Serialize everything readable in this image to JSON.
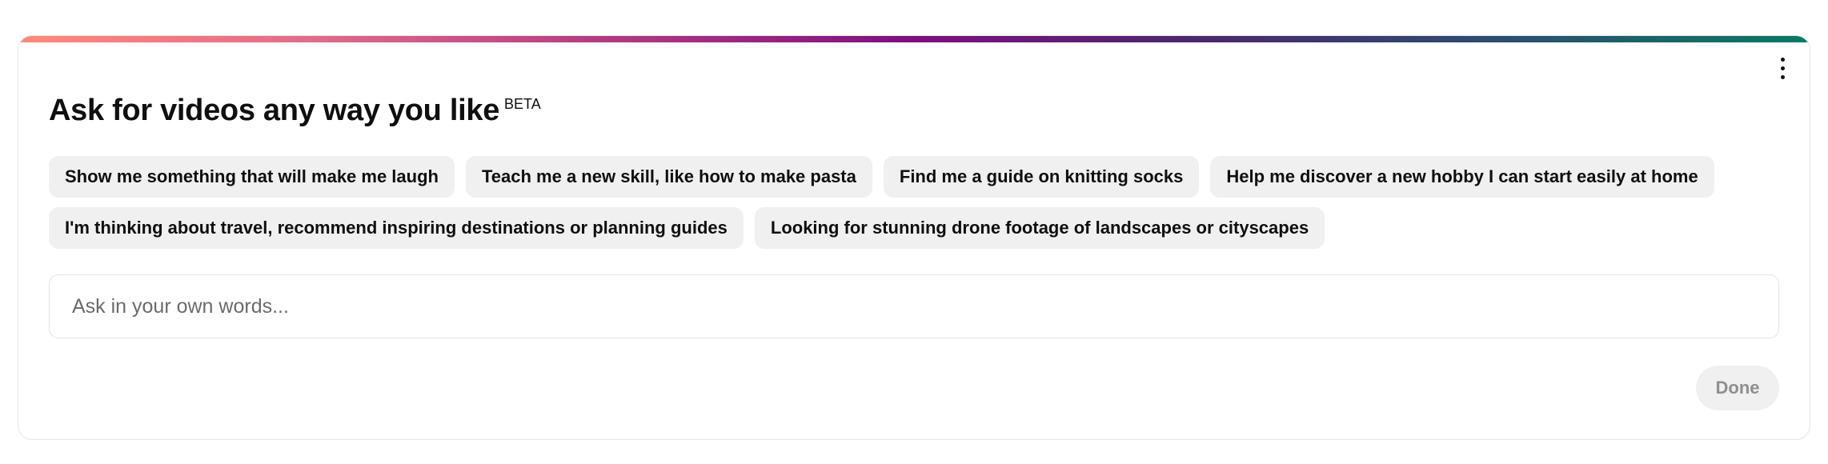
{
  "theme": {
    "gradient_stops": [
      "#ff8a7a",
      "#e06b8a",
      "#b03a82",
      "#7d0f80",
      "#4a2a6e",
      "#2a4f6e",
      "#0a7a64"
    ],
    "chip_bg": "#f0f0f0",
    "border": "#e5e5e5"
  },
  "header": {
    "title": "Ask for videos any way you like",
    "badge": "BETA",
    "menu_icon": "more-vertical-icon"
  },
  "suggestions": [
    "Show me something that will make me laugh",
    "Teach me a new skill, like how to make pasta",
    "Find me a guide on knitting socks",
    "Help me discover a new hobby I can start easily at home",
    "I'm thinking about travel, recommend inspiring destinations or planning guides",
    "Looking for stunning drone footage of landscapes or cityscapes"
  ],
  "prompt": {
    "placeholder": "Ask in your own words...",
    "value": ""
  },
  "actions": {
    "done_label": "Done"
  }
}
